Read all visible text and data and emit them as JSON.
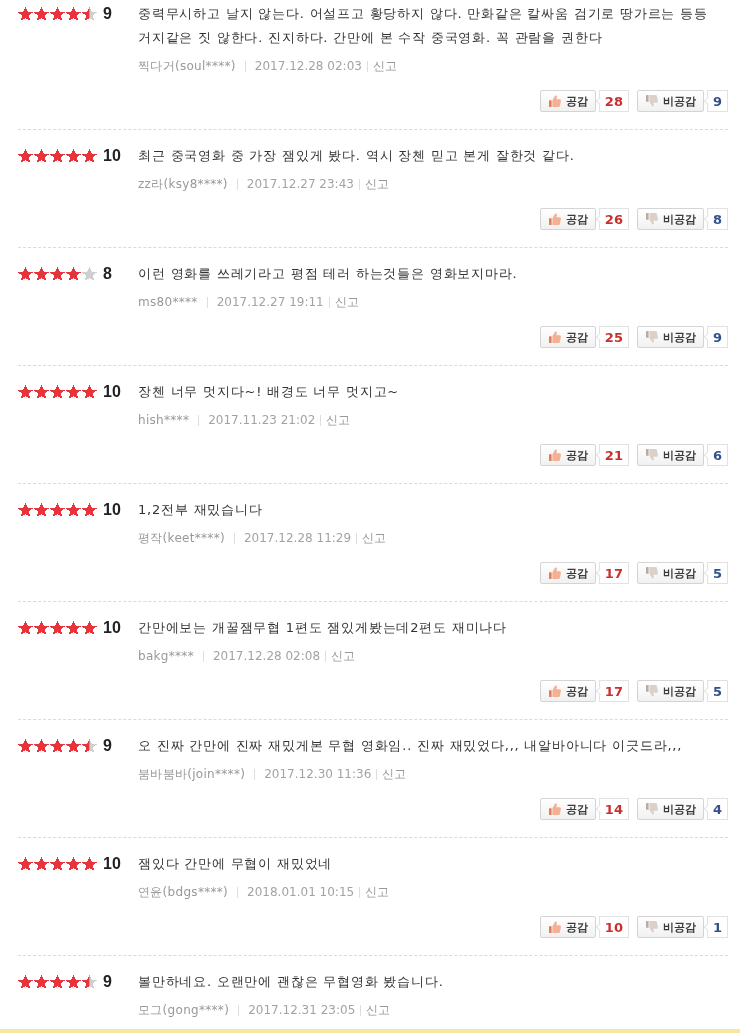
{
  "reviews": [
    {
      "stars": 4.5,
      "score": "9",
      "text": "중력무시하고 날지 않는다. 어설프고 황당하지 않다. 만화같은 칼싸움 검기로 땅가르는 등등 거지같은 짓 않한다. 진지하다. 간만에 본 수작 중국영화. 꼭 관람을 권한다",
      "author": "찍다거(soul****)",
      "date": "2017.12.28 02:03",
      "report": "신고",
      "votes": [
        {
          "kind": "like",
          "label": "공감",
          "count": "28"
        },
        {
          "kind": "dislike",
          "label": "비공감",
          "count": "9"
        }
      ]
    },
    {
      "stars": 5,
      "score": "10",
      "text": "최근 중국영화 중 가장 잼있게 봤다. 역시 장첸 믿고 본게 잘한것 같다.",
      "author": "zz라(ksy8****)",
      "date": "2017.12.27 23:43",
      "report": "신고",
      "votes": [
        {
          "kind": "like",
          "label": "공감",
          "count": "26"
        },
        {
          "kind": "dislike",
          "label": "비공감",
          "count": "8"
        }
      ]
    },
    {
      "stars": 4,
      "score": "8",
      "text": "이런 영화를 쓰레기라고 평점 테러 하는것들은 영화보지마라.",
      "author": "ms80****",
      "date": "2017.12.27 19:11",
      "report": "신고",
      "votes": [
        {
          "kind": "like",
          "label": "공감",
          "count": "25"
        },
        {
          "kind": "dislike",
          "label": "비공감",
          "count": "9"
        }
      ]
    },
    {
      "stars": 5,
      "score": "10",
      "text": "장첸 너무 멋지다~! 배경도 너무 멋지고~",
      "author": "hish****",
      "date": "2017.11.23 21:02",
      "report": "신고",
      "votes": [
        {
          "kind": "like",
          "label": "공감",
          "count": "21"
        },
        {
          "kind": "dislike",
          "label": "비공감",
          "count": "6"
        }
      ]
    },
    {
      "stars": 5,
      "score": "10",
      "text": "1,2전부 재밌습니다",
      "author": "평작(keet****)",
      "date": "2017.12.28 11:29",
      "report": "신고",
      "votes": [
        {
          "kind": "like",
          "label": "공감",
          "count": "17"
        },
        {
          "kind": "dislike",
          "label": "비공감",
          "count": "5"
        }
      ]
    },
    {
      "stars": 5,
      "score": "10",
      "text": "간만에보는 개꿀잼무협 1편도 잼있게봤는데2편도 재미나다",
      "author": "bakg****",
      "date": "2017.12.28 02:08",
      "report": "신고",
      "votes": [
        {
          "kind": "like",
          "label": "공감",
          "count": "17"
        },
        {
          "kind": "dislike",
          "label": "비공감",
          "count": "5"
        }
      ]
    },
    {
      "stars": 4.5,
      "score": "9",
      "text": "오 진짜 간만에 진짜 재밌게본 무협 영화임.. 진짜 재밌었다,,, 내알바아니다 이긋드라,,,",
      "author": "붐바붐바(join****)",
      "date": "2017.12.30 11:36",
      "report": "신고",
      "votes": [
        {
          "kind": "like",
          "label": "공감",
          "count": "14"
        },
        {
          "kind": "dislike",
          "label": "비공감",
          "count": "4"
        }
      ]
    },
    {
      "stars": 5,
      "score": "10",
      "text": "잼있다 간만에 무협이 재밌었네",
      "author": "연윤(bdgs****)",
      "date": "2018.01.01 10:15",
      "report": "신고",
      "votes": [
        {
          "kind": "like",
          "label": "공감",
          "count": "10"
        },
        {
          "kind": "dislike",
          "label": "비공감",
          "count": "1"
        }
      ]
    },
    {
      "stars": 4.5,
      "score": "9",
      "text": "볼만하네요. 오랜만에 괜찮은 무협영화 봤습니다.",
      "author": "모그(gong****)",
      "date": "2017.12.31 23:05",
      "report": "신고"
    }
  ]
}
